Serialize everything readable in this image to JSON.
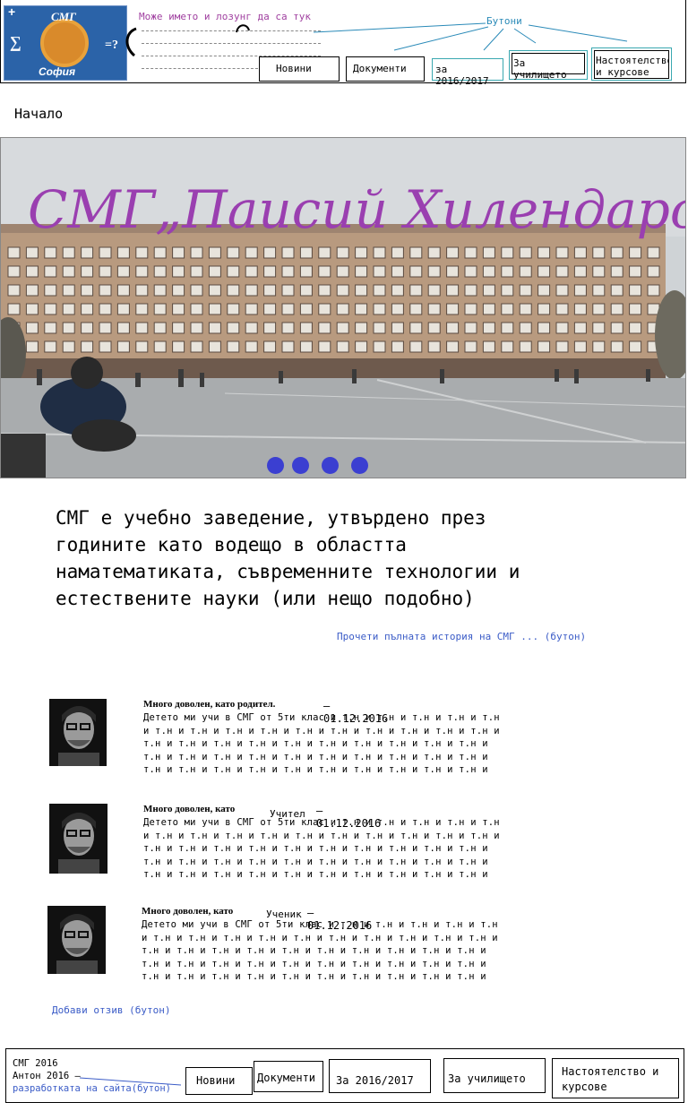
{
  "header": {
    "logo_text_top": "СМГ",
    "logo_text_bottom": "София",
    "logo_symbol_left": "∑",
    "logo_symbol_right": "=?",
    "slogan": "Може името и лозунг да са тук",
    "buttons_note": "Бутони",
    "nav": {
      "news": "Новини",
      "documents": "Документи",
      "year": "за 2016/2017",
      "about": "За училището",
      "board": "Настоятелство и курсове"
    }
  },
  "breadcrumb": "Начало",
  "hero": {
    "title": "СМГ„Паисий Хилендарски“",
    "dots": 4
  },
  "intro_text": "СМГ е учебно заведение, утвърдено през\nгодините като водещо в областта\nнаматематиката, съвременните технологии и\nестествените науки (или нещо подобно)",
  "read_more": "Прочети пълната история на СМГ ... (бутон)",
  "reviews": [
    {
      "title": "Много доволен, като родител.",
      "role": "",
      "date": "– 01.12.2016",
      "body": "Детето ми учи в СМГ от 5ти клас и т.н и т.н и т.н и т.н и т.н\nи т.н и т.н и т.н и т.н и т.н и т.н и т.н и т.н и т.н и т.н и\nт.н и т.н и т.н и т.н и т.н и т.н и т.н и т.н и т.н и т.н и\nт.н и т.н и т.н и т.н и т.н и т.н и т.н и т.н и т.н и т.н и\nт.н и т.н и т.н и т.н и т.н и т.н и т.н и т.н и т.н и т.н и"
    },
    {
      "title": "Много доволен, като",
      "role": "Учител",
      "date": "– 01.12.2016",
      "body": "Детето ми учи в СМГ от 5ти клас и т.н и т.н и т.н и т.н и т.н\nи т.н и т.н и т.н и т.н и т.н и т.н и т.н и т.н и т.н и т.н и\nт.н и т.н и т.н и т.н и т.н и т.н и т.н и т.н и т.н и т.н и\nт.н и т.н и т.н и т.н и т.н и т.н и т.н и т.н и т.н и т.н и\nт.н и т.н и т.н и т.н и т.н и т.н и т.н и т.н и т.н и т.н и"
    },
    {
      "title": "Много доволен, като",
      "role": "Ученик",
      "date": "– 01.12.2016",
      "body": "Детето ми учи в СМГ от 5ти клас и т.н и т.н и т.н и т.н и т.н\nи т.н и т.н и т.н и т.н и т.н и т.н и т.н и т.н и т.н и т.н и\nт.н и т.н и т.н и т.н и т.н и т.н и т.н и т.н и т.н и т.н и\nт.н и т.н и т.н и т.н и т.н и т.н и т.н и т.н и т.н и т.н и\nт.н и т.н и т.н и т.н и т.н и т.н и т.н и т.н и т.н и т.н и"
    }
  ],
  "add_review": "Добави отзив (бутон)",
  "footer": {
    "copyright_1": "СМГ 2016",
    "copyright_2": "Антон 2016 –",
    "dev_link": "разработката на сайта(бутон)",
    "nav": {
      "news": "Новини",
      "documents": "Документи",
      "year": "За 2016/2017",
      "about": "За училището",
      "board": "Настоятелство и курсове"
    }
  },
  "colors": {
    "accent_blue": "#3b3fd1",
    "link_blue": "#3b5cc7",
    "slogan_purple": "#a040a0",
    "note_teal": "#2a8ab8",
    "hero_title": "#9a3fb0"
  }
}
